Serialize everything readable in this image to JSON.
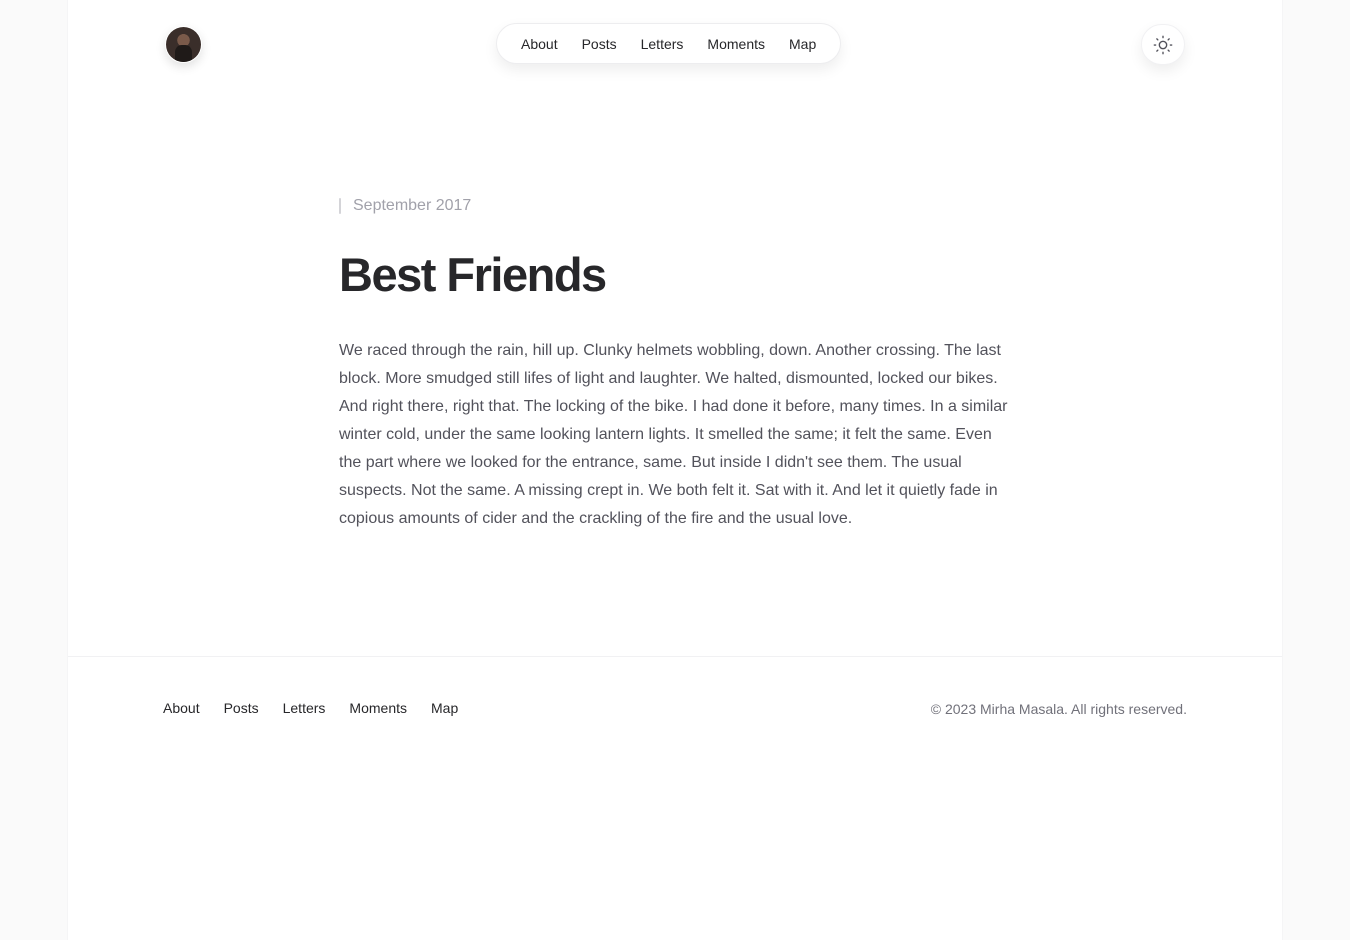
{
  "header": {
    "nav": [
      "About",
      "Posts",
      "Letters",
      "Moments",
      "Map"
    ]
  },
  "article": {
    "date": "September 2017",
    "title": "Best Friends",
    "body": "We raced through the rain, hill up. Clunky helmets wobbling, down. Another crossing. The last block. More smudged still lifes of light and laughter. We halted, dismounted, locked our bikes. And right there, right that. The locking of the bike. I had done it before, many times. In a similar winter cold, under the same looking lantern lights. It smelled the same; it felt the same. Even the part where we looked for the entrance, same. But inside I didn't see them. The usual suspects. Not the same. A missing crept in. We both felt it. Sat with it. And let it quietly fade in copious amounts of cider and the crackling of the fire and the usual love."
  },
  "footer": {
    "nav": [
      "About",
      "Posts",
      "Letters",
      "Moments",
      "Map"
    ],
    "copyright": "© 2023 Mirha Masala. All rights reserved."
  },
  "icons": {
    "theme_toggle": "sun-icon",
    "avatar": "avatar"
  },
  "colors": {
    "text": "#27272a",
    "muted": "#a1a1aa",
    "body": "#52525b",
    "background": "#fafafa"
  }
}
